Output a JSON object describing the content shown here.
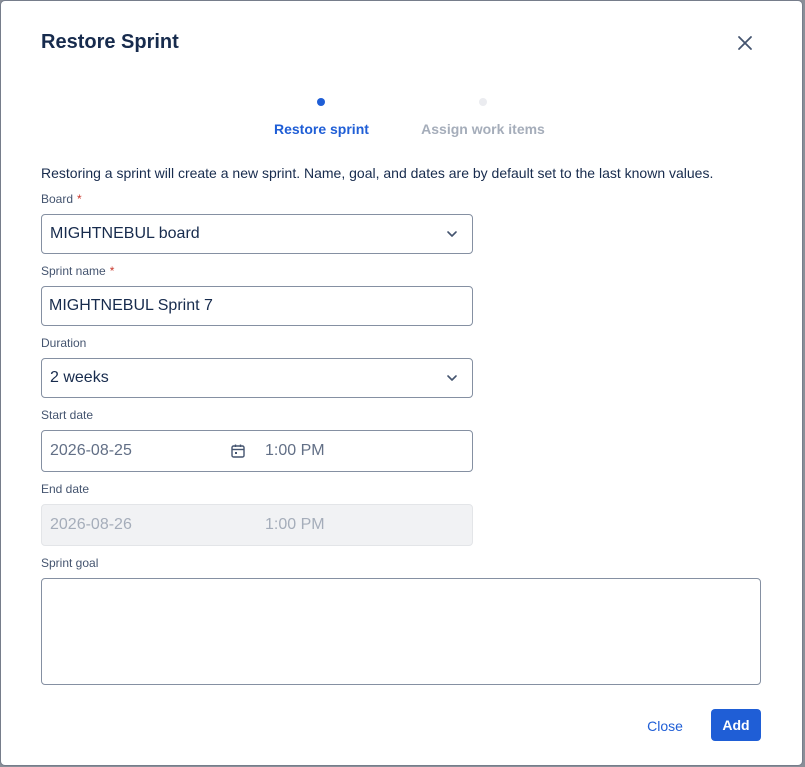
{
  "dialog": {
    "title": "Restore Sprint",
    "close_icon": "close-icon"
  },
  "steps": [
    {
      "label": "Restore sprint",
      "active": true
    },
    {
      "label": "Assign work items",
      "active": false
    }
  ],
  "intro_text": "Restoring a sprint will create a new sprint. Name, goal, and dates are by default set to the last known values.",
  "form": {
    "board": {
      "label": "Board",
      "required_mark": "*",
      "value": "MIGHTNEBUL board"
    },
    "sprint_name": {
      "label": "Sprint name",
      "required_mark": "*",
      "value": "MIGHTNEBUL Sprint 7"
    },
    "duration": {
      "label": "Duration",
      "value": "2 weeks"
    },
    "start_date": {
      "label": "Start date",
      "date": "2026-08-25",
      "time": "1:00 PM"
    },
    "end_date": {
      "label": "End date",
      "date": "2026-08-26",
      "time": "1:00 PM"
    },
    "sprint_goal": {
      "label": "Sprint goal",
      "value": ""
    }
  },
  "footer": {
    "close_label": "Close",
    "add_label": "Add"
  },
  "colors": {
    "accent": "#1f5ed6",
    "required": "#c9372c",
    "inactive_step": "#a5adba"
  }
}
